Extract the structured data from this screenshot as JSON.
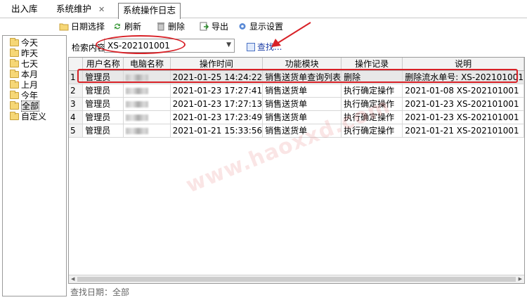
{
  "tabs": [
    {
      "label": "出入库",
      "closable": false
    },
    {
      "label": "系统维护",
      "closable": true
    },
    {
      "label": "系统操作日志",
      "active": true,
      "closable": false
    }
  ],
  "toolbar": {
    "date_select": "日期选择",
    "refresh": "刷新",
    "delete": "删除",
    "export": "导出",
    "display_settings": "显示设置"
  },
  "tree": {
    "items": [
      "今天",
      "昨天",
      "七天",
      "本月",
      "上月",
      "今年",
      "全部",
      "自定义"
    ],
    "selected": "全部"
  },
  "search": {
    "label": "检索内容",
    "value": "XS-202101001",
    "find_label": "查找..."
  },
  "table": {
    "columns": [
      "",
      "用户名称",
      "电脑名称",
      "操作时间",
      "功能模块",
      "操作记录",
      "说明"
    ],
    "rows": [
      {
        "idx": "1",
        "user": "管理员",
        "computer": "",
        "time": "2021-01-25 14:24:22",
        "module": "销售送货单查询列表",
        "action": "删除",
        "note": "删除流水单号: XS-202101001"
      },
      {
        "idx": "2",
        "user": "管理员",
        "computer": "",
        "time": "2021-01-23 17:27:41",
        "module": "销售送货单",
        "action": "执行确定操作",
        "note": "2021-01-08 XS-202101001"
      },
      {
        "idx": "3",
        "user": "管理员",
        "computer": "",
        "time": "2021-01-23 17:27:13",
        "module": "销售送货单",
        "action": "执行确定操作",
        "note": "2021-01-23 XS-202101001"
      },
      {
        "idx": "4",
        "user": "管理员",
        "computer": "",
        "time": "2021-01-23 17:23:49",
        "module": "销售送货单",
        "action": "执行确定操作",
        "note": "2021-01-23 XS-202101001"
      },
      {
        "idx": "5",
        "user": "管理员",
        "computer": "",
        "time": "2021-01-21 15:33:56",
        "module": "销售送货单",
        "action": "执行确定操作",
        "note": "2021-01-21 XS-202101001"
      }
    ]
  },
  "status": "查找日期：全部",
  "watermark": "www.haoxxd.com",
  "colors": {
    "annotation": "#d82127"
  }
}
